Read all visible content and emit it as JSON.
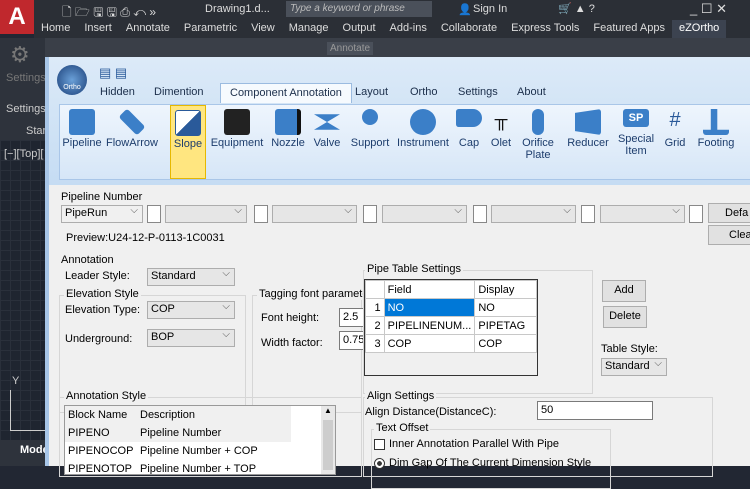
{
  "app": {
    "logo": "A",
    "title": "Drawing1.d...",
    "search_placeholder": "Type a keyword or phrase",
    "sign_in": "Sign In"
  },
  "menu": [
    "Home",
    "Insert",
    "Annotate",
    "Parametric",
    "View",
    "Manage",
    "Output",
    "Add-ins",
    "Collaborate",
    "Express Tools",
    "Featured Apps",
    "eZOrtho"
  ],
  "left": {
    "settings": "Settings",
    "settings2": "Settings",
    "start": "Star",
    "view": "[−][Top][",
    "ribbon_annotate": "Annotate",
    "model": "Mode",
    "axis_y": "Y"
  },
  "plugin": {
    "logo": "Ortho",
    "tabs": [
      "Hidden",
      "Dimention",
      "Component Annotation",
      "Layout",
      "Ortho",
      "Settings",
      "About"
    ],
    "active_tab": "Component Annotation",
    "tools": [
      "Pipeline",
      "FlowArrow",
      "Slope",
      "Equipment",
      "Nozzle",
      "Valve",
      "Support",
      "Instrument",
      "Cap",
      "Olet",
      "Orifice Plate",
      "Reducer",
      "Special Item",
      "Grid",
      "Footing"
    ],
    "selected_tool": "Slope"
  },
  "pipeline_number": {
    "label": "Pipeline Number",
    "first": "PipeRun",
    "preview": "Preview:U24-12-P-0113-1C0031",
    "default_btn": "Defa",
    "clear_btn": "Clea"
  },
  "annotation": {
    "label": "Annotation",
    "leader_label": "Leader Style:",
    "leader": "Standard",
    "elev_group": "Elevation Style",
    "elev_type_label": "Elevation Type:",
    "elev_type": "COP",
    "underground_label": "Underground:",
    "underground": "BOP",
    "tag_group": "Tagging font parameters",
    "font_height_label": "Font height:",
    "font_height": "2.5",
    "width_factor_label": "Width factor:",
    "width_factor": "0.75"
  },
  "pipe_table": {
    "label": "Pipe Table Settings",
    "headers": [
      "Field",
      "Display"
    ],
    "rows": [
      [
        "1",
        "NO",
        "NO"
      ],
      [
        "2",
        "PIPELINENUM...",
        "PIPETAG"
      ],
      [
        "3",
        "COP",
        "COP"
      ]
    ],
    "add": "Add",
    "delete": "Delete",
    "style_label": "Table Style:",
    "style": "Standard"
  },
  "anno_style": {
    "label": "Annotation Style",
    "headers": [
      "Block Name",
      "Description"
    ],
    "rows": [
      [
        "PIPENO",
        "Pipeline Number"
      ],
      [
        "PIPENOCOP",
        "Pipeline Number + COP"
      ],
      [
        "PIPENOTOP",
        "Pipeline Number + TOP"
      ]
    ]
  },
  "align": {
    "label": "Align Settings",
    "distance_label": "Align Distance(DistanceC):",
    "distance": "50",
    "offset_group": "Text Offset",
    "inner_parallel": "Inner Annotation Parallel With Pipe",
    "dim_gap": "Dim Gap Of The Current Dimension Style"
  }
}
